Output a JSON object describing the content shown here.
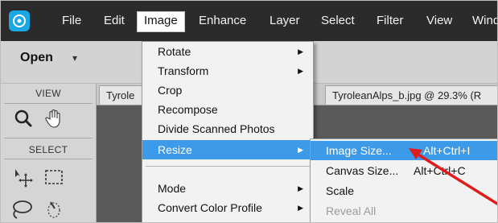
{
  "menubar": {
    "items": [
      {
        "label": "File"
      },
      {
        "label": "Edit"
      },
      {
        "label": "Image"
      },
      {
        "label": "Enhance"
      },
      {
        "label": "Layer"
      },
      {
        "label": "Select"
      },
      {
        "label": "Filter"
      },
      {
        "label": "View"
      },
      {
        "label": "Wind"
      }
    ],
    "active": "Image",
    "logo_icon": "elements-logo-icon"
  },
  "toolbar": {
    "open_label": "Open",
    "open_caret": "▾"
  },
  "leftpanel": {
    "view_label": "VIEW",
    "select_label": "SELECT",
    "tools": [
      "zoom-icon",
      "hand-icon",
      "move-icon",
      "marquee-icon",
      "lasso-icon",
      "quick-selection-icon"
    ]
  },
  "tabs": [
    {
      "label": "Tyrole"
    },
    {
      "label": "TyroleanAlps_b.jpg @ 29.3% (R"
    }
  ],
  "image_menu": {
    "items": [
      {
        "label": "Rotate",
        "submenu": true
      },
      {
        "label": "Transform",
        "submenu": true
      },
      {
        "label": "Crop",
        "submenu": false
      },
      {
        "label": "Recompose",
        "submenu": false
      },
      {
        "label": "Divide Scanned Photos",
        "submenu": false
      },
      {
        "label": "Resize",
        "submenu": true,
        "highlighted": true
      },
      {
        "label": "Mode",
        "submenu": true
      },
      {
        "label": "Convert Color Profile",
        "submenu": true
      }
    ]
  },
  "resize_submenu": {
    "items": [
      {
        "label": "Image Size...",
        "shortcut": "Alt+Ctrl+I",
        "highlighted": true
      },
      {
        "label": "Canvas Size...",
        "shortcut": "Alt+Ctrl+C"
      },
      {
        "label": "Scale",
        "shortcut": ""
      },
      {
        "label": "Reveal All",
        "shortcut": "",
        "disabled": true
      }
    ]
  },
  "colors": {
    "menubar_bg": "#2b2b2b",
    "highlight": "#3d9ae8",
    "annotation_arrow": "#e01b1b",
    "logo": "#1aa7e4"
  }
}
